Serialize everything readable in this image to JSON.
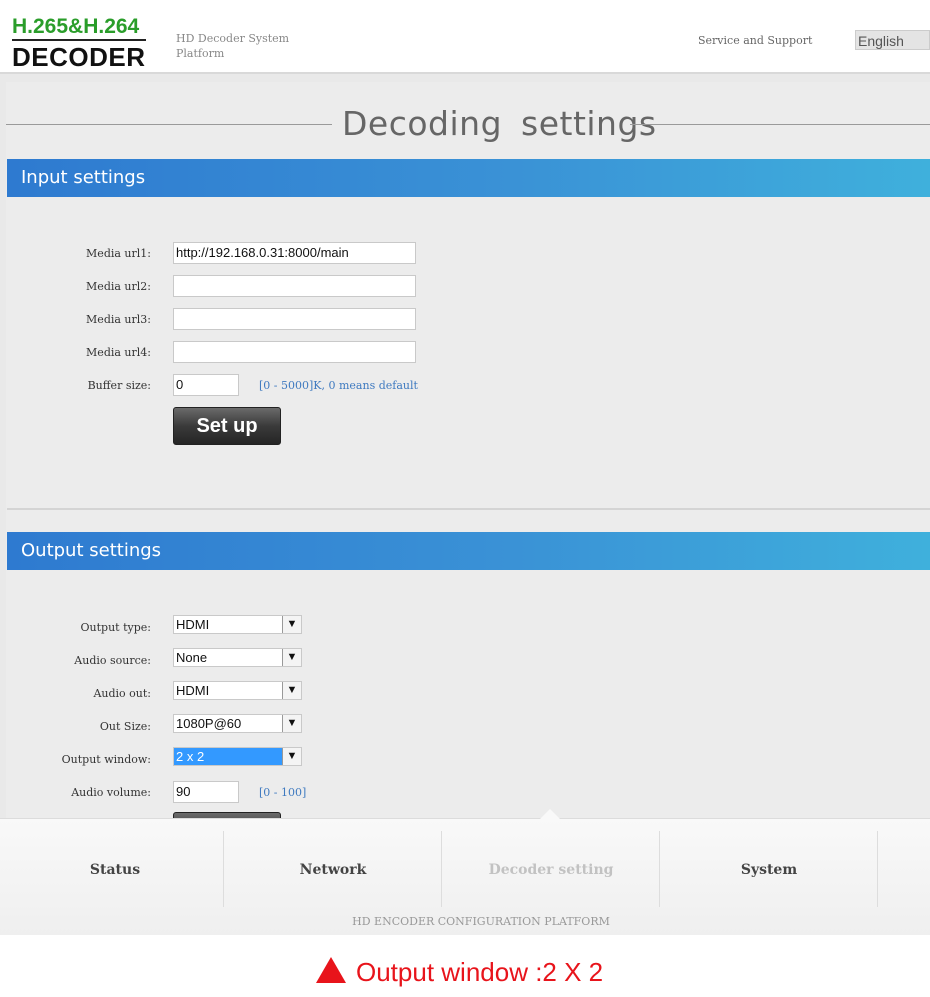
{
  "header": {
    "logo_top": "H.265&H.264",
    "logo_bottom": "DECODER",
    "platform_line1": "HD Decoder System",
    "platform_line2": "Platform",
    "service_link": "Service and Support",
    "language": "English"
  },
  "page": {
    "title": "Decoding settings"
  },
  "input_settings": {
    "title": "Input settings",
    "fields": [
      {
        "label": "Media url1:",
        "value": "http://192.168.0.31:8000/main"
      },
      {
        "label": "Media url2:",
        "value": ""
      },
      {
        "label": "Media url3:",
        "value": ""
      },
      {
        "label": "Media url4:",
        "value": ""
      }
    ],
    "buffer": {
      "label": "Buffer size:",
      "value": "0",
      "hint": "[0 - 5000]K, 0 means default"
    },
    "setup_button": "Set up"
  },
  "output_settings": {
    "title": "Output settings",
    "fields": [
      {
        "label": "Output type:",
        "value": "HDMI"
      },
      {
        "label": "Audio source:",
        "value": "None"
      },
      {
        "label": "Audio out:",
        "value": "HDMI"
      },
      {
        "label": "Out Size:",
        "value": "1080P@60"
      },
      {
        "label": "Output window:",
        "value": "2 x 2"
      }
    ],
    "volume": {
      "label": "Audio volume:",
      "value": "90",
      "hint": "[0 - 100]"
    }
  },
  "nav": {
    "items": [
      "Status",
      "Network",
      "Decoder setting",
      "System"
    ],
    "active": "Decoder setting",
    "footer": "HD ENCODER CONFIGURATION PLATFORM"
  },
  "caption": {
    "text": "Output window :2 X 2",
    "color": "#e8141b"
  },
  "colors": {
    "band_start": "#2e7ad0",
    "band_end": "#3fb0dc",
    "logo_green": "#2a9d2a",
    "selected_option": "#3399ff"
  }
}
